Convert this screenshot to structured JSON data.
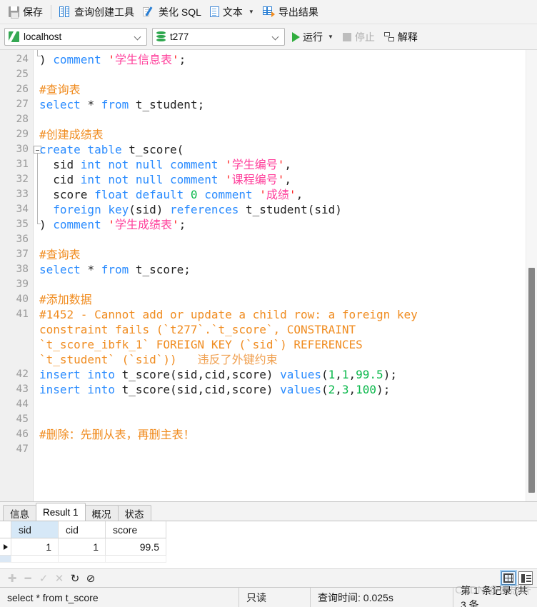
{
  "toolbar": {
    "save": "保存",
    "query_builder": "查询创建工具",
    "beautify_sql": "美化 SQL",
    "text": "文本",
    "export_results": "导出结果"
  },
  "connbar": {
    "connection": "localhost",
    "database": "t277",
    "run": "运行",
    "stop": "停止",
    "explain": "解释"
  },
  "editor": {
    "first_visible_line": 24,
    "lines": [
      {
        "n": "24",
        "tokens": [
          {
            "t": ") ",
            "c": "plain"
          },
          {
            "t": "comment ",
            "c": "kw"
          },
          {
            "t": "'",
            "c": "q"
          },
          {
            "t": "学生信息表",
            "c": "str"
          },
          {
            "t": "'",
            "c": "q"
          },
          {
            "t": ";",
            "c": "plain"
          }
        ]
      },
      {
        "n": "25",
        "tokens": []
      },
      {
        "n": "26",
        "tokens": [
          {
            "t": "#查询表",
            "c": "cmt"
          }
        ]
      },
      {
        "n": "27",
        "tokens": [
          {
            "t": "select ",
            "c": "kw"
          },
          {
            "t": "* ",
            "c": "plain"
          },
          {
            "t": "from ",
            "c": "kw"
          },
          {
            "t": "t_student;",
            "c": "plain"
          }
        ]
      },
      {
        "n": "28",
        "tokens": []
      },
      {
        "n": "29",
        "tokens": [
          {
            "t": "#创建成绩表",
            "c": "cmt"
          }
        ]
      },
      {
        "n": "30",
        "tokens": [
          {
            "t": "create table ",
            "c": "kw"
          },
          {
            "t": "t_score(",
            "c": "plain"
          }
        ]
      },
      {
        "n": "31",
        "tokens": [
          {
            "t": "  sid ",
            "c": "plain"
          },
          {
            "t": "int not null comment ",
            "c": "kw"
          },
          {
            "t": "'",
            "c": "q"
          },
          {
            "t": "学生编号",
            "c": "str"
          },
          {
            "t": "'",
            "c": "q"
          },
          {
            "t": ",",
            "c": "plain"
          }
        ]
      },
      {
        "n": "32",
        "tokens": [
          {
            "t": "  cid ",
            "c": "plain"
          },
          {
            "t": "int not null comment ",
            "c": "kw"
          },
          {
            "t": "'",
            "c": "q"
          },
          {
            "t": "课程编号",
            "c": "str"
          },
          {
            "t": "'",
            "c": "q"
          },
          {
            "t": ",",
            "c": "plain"
          }
        ]
      },
      {
        "n": "33",
        "tokens": [
          {
            "t": "  score ",
            "c": "plain"
          },
          {
            "t": "float default ",
            "c": "kw"
          },
          {
            "t": "0",
            "c": "num"
          },
          {
            "t": " comment ",
            "c": "kw"
          },
          {
            "t": "'",
            "c": "q"
          },
          {
            "t": "成绩",
            "c": "str"
          },
          {
            "t": "'",
            "c": "q"
          },
          {
            "t": ",",
            "c": "plain"
          }
        ]
      },
      {
        "n": "34",
        "tokens": [
          {
            "t": "  ",
            "c": "plain"
          },
          {
            "t": "foreign key",
            "c": "kw"
          },
          {
            "t": "(sid) ",
            "c": "plain"
          },
          {
            "t": "references ",
            "c": "kw"
          },
          {
            "t": "t_student(sid)",
            "c": "plain"
          }
        ]
      },
      {
        "n": "35",
        "tokens": [
          {
            "t": ") ",
            "c": "plain"
          },
          {
            "t": "comment ",
            "c": "kw"
          },
          {
            "t": "'",
            "c": "q"
          },
          {
            "t": "学生成绩表",
            "c": "str"
          },
          {
            "t": "'",
            "c": "q"
          },
          {
            "t": ";",
            "c": "plain"
          }
        ]
      },
      {
        "n": "36",
        "tokens": []
      },
      {
        "n": "37",
        "tokens": [
          {
            "t": "#查询表",
            "c": "cmt"
          }
        ]
      },
      {
        "n": "38",
        "tokens": [
          {
            "t": "select ",
            "c": "kw"
          },
          {
            "t": "* ",
            "c": "plain"
          },
          {
            "t": "from ",
            "c": "kw"
          },
          {
            "t": "t_score;",
            "c": "plain"
          }
        ]
      },
      {
        "n": "39",
        "tokens": []
      },
      {
        "n": "40",
        "tokens": [
          {
            "t": "#添加数据",
            "c": "cmt"
          }
        ]
      },
      {
        "n": "41",
        "tokens": [
          {
            "t": "#1452 - Cannot add or update a child row: a foreign key",
            "c": "cmt"
          }
        ]
      },
      {
        "n": "",
        "tokens": [
          {
            "t": "constraint fails (`t277`.`t_score`, CONSTRAINT",
            "c": "cmt"
          }
        ]
      },
      {
        "n": "",
        "tokens": [
          {
            "t": "`t_score_ibfk_1` FOREIGN KEY (`sid`) REFERENCES",
            "c": "cmt"
          }
        ]
      },
      {
        "n": "",
        "tokens": [
          {
            "t": "`t_student` (`sid`))   ",
            "c": "cmt"
          },
          {
            "t": "违反了外键约束",
            "c": "cmt-cn"
          }
        ]
      },
      {
        "n": "42",
        "tokens": [
          {
            "t": "insert into ",
            "c": "kw"
          },
          {
            "t": "t_score(sid,cid,score) ",
            "c": "plain"
          },
          {
            "t": "values",
            "c": "kw"
          },
          {
            "t": "(",
            "c": "plain"
          },
          {
            "t": "1",
            "c": "num"
          },
          {
            "t": ",",
            "c": "plain"
          },
          {
            "t": "1",
            "c": "num"
          },
          {
            "t": ",",
            "c": "plain"
          },
          {
            "t": "99.5",
            "c": "num"
          },
          {
            "t": ");",
            "c": "plain"
          }
        ]
      },
      {
        "n": "43",
        "tokens": [
          {
            "t": "insert into ",
            "c": "kw"
          },
          {
            "t": "t_score(sid,cid,score) ",
            "c": "plain"
          },
          {
            "t": "values",
            "c": "kw"
          },
          {
            "t": "(",
            "c": "plain"
          },
          {
            "t": "2",
            "c": "num"
          },
          {
            "t": ",",
            "c": "plain"
          },
          {
            "t": "3",
            "c": "num"
          },
          {
            "t": ",",
            "c": "plain"
          },
          {
            "t": "100",
            "c": "num"
          },
          {
            "t": ");",
            "c": "plain"
          }
        ]
      },
      {
        "n": "44",
        "tokens": []
      },
      {
        "n": "45",
        "tokens": []
      },
      {
        "n": "46",
        "tokens": [
          {
            "t": "#删除：先删从表，再删主表！",
            "c": "cmt"
          }
        ]
      },
      {
        "n": "47",
        "tokens": []
      }
    ]
  },
  "results": {
    "tabs": [
      {
        "label": "信息",
        "active": false
      },
      {
        "label": "Result 1",
        "active": true
      },
      {
        "label": "概况",
        "active": false
      },
      {
        "label": "状态",
        "active": false
      }
    ],
    "columns": [
      "sid",
      "cid",
      "score"
    ],
    "rows": [
      [
        "1",
        "1",
        "99.5"
      ]
    ],
    "nav_icons": [
      "+",
      "−",
      "✓",
      "✗",
      "↻",
      "⊘"
    ],
    "view_modes": [
      "grid-view",
      "form-view"
    ],
    "active_view": "grid-view"
  },
  "statusbar": {
    "sql": "select * from t_score",
    "readonly": "只读",
    "query_time": "查询时间: 0.025s",
    "record_info": "第 1 条记录 (共 3 条"
  },
  "watermark": "CSDN @明思齐",
  "colors": {
    "keyword": "#2b8cff",
    "string": "#ff3d9a",
    "quote": "#ff2020",
    "number": "#0ab84b",
    "comment": "#f08c20",
    "accent_green": "#30ad3e",
    "selection": "#d6e8f7"
  }
}
